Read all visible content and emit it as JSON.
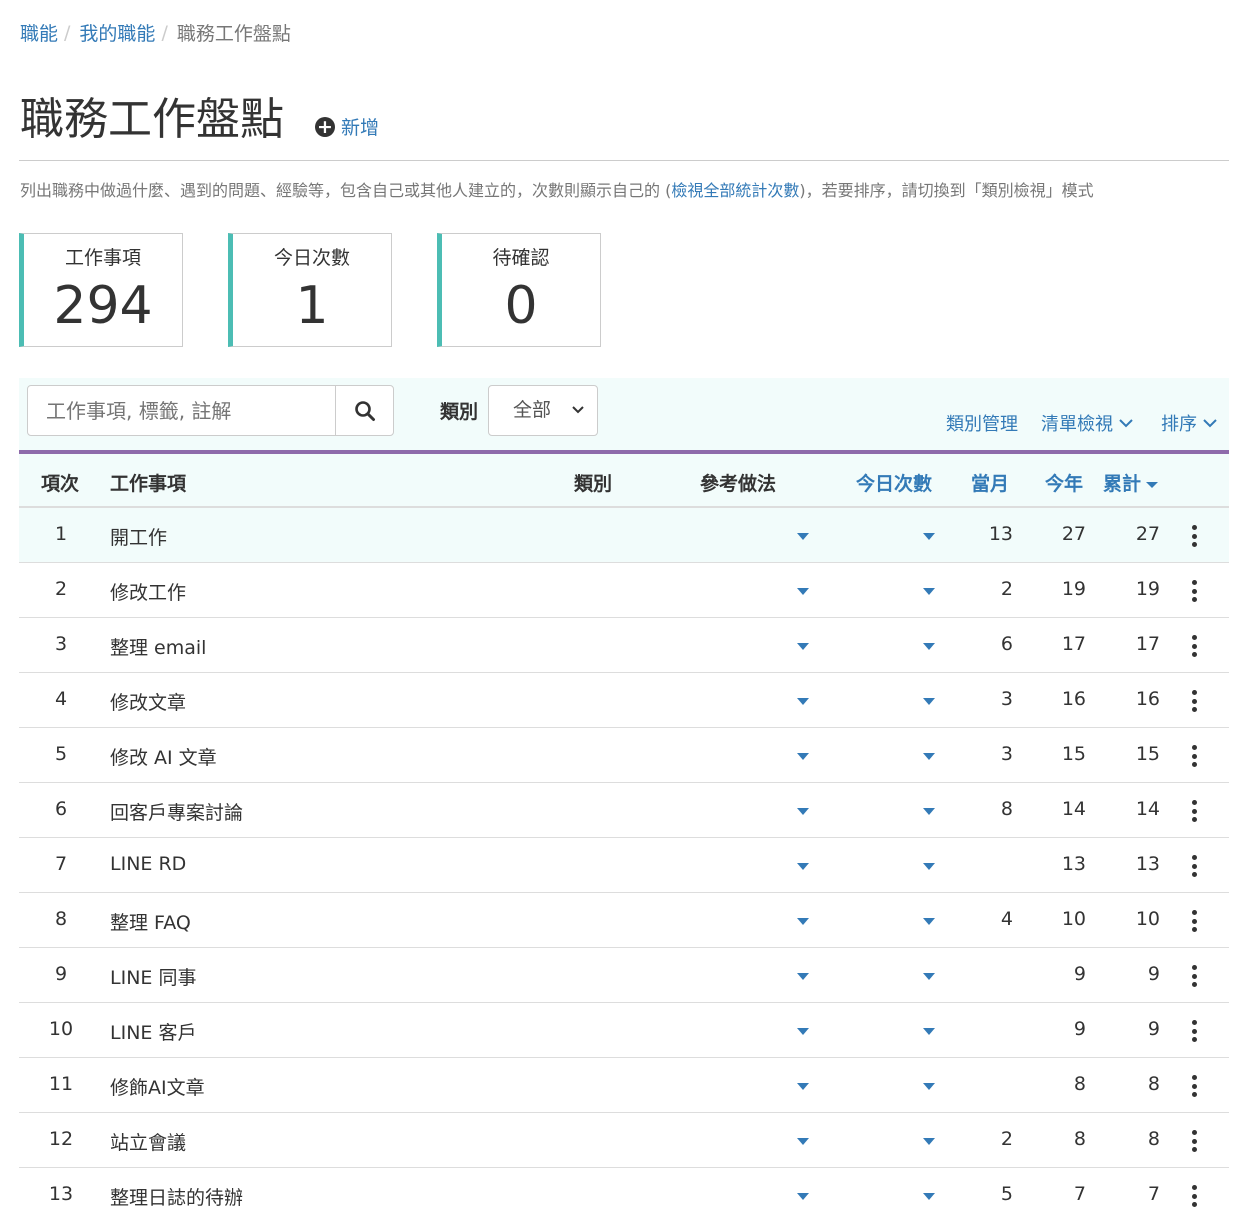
{
  "breadcrumb": {
    "items": [
      "職能",
      "我的職能"
    ],
    "current": "職務工作盤點",
    "separator": "/"
  },
  "header": {
    "title": "職務工作盤點",
    "add_label": "新增"
  },
  "description": {
    "before": "列出職務中做過什麼、遇到的問題、經驗等，包含自己或其他人建立的，次數則顯示自己的 (",
    "link": "檢視全部統計次數",
    "after": ")，若要排序，請切換到「類別檢視」模式"
  },
  "stats": [
    {
      "label": "工作事項",
      "value": "294"
    },
    {
      "label": "今日次數",
      "value": "1"
    },
    {
      "label": "待確認",
      "value": "0"
    }
  ],
  "toolbar": {
    "search_placeholder": "工作事項, 標籤, 註解",
    "category_label": "類別",
    "category_selected": "全部",
    "links": [
      "類別管理",
      "清單檢視",
      "排序"
    ]
  },
  "table": {
    "columns": [
      "項次",
      "工作事項",
      "類別",
      "參考做法",
      "今日次數",
      "當月",
      "今年",
      "累計"
    ],
    "rows": [
      {
        "no": "1",
        "item": "開工作",
        "month": "13",
        "year": "27",
        "total": "27"
      },
      {
        "no": "2",
        "item": "修改工作",
        "month": "2",
        "year": "19",
        "total": "19"
      },
      {
        "no": "3",
        "item": "整理 email",
        "month": "6",
        "year": "17",
        "total": "17"
      },
      {
        "no": "4",
        "item": "修改文章",
        "month": "3",
        "year": "16",
        "total": "16"
      },
      {
        "no": "5",
        "item": "修改 AI 文章",
        "month": "3",
        "year": "15",
        "total": "15"
      },
      {
        "no": "6",
        "item": "回客戶專案討論",
        "month": "8",
        "year": "14",
        "total": "14"
      },
      {
        "no": "7",
        "item": "LINE RD",
        "month": "",
        "year": "13",
        "total": "13"
      },
      {
        "no": "8",
        "item": "整理 FAQ",
        "month": "4",
        "year": "10",
        "total": "10"
      },
      {
        "no": "9",
        "item": "LINE 同事",
        "month": "",
        "year": "9",
        "total": "9"
      },
      {
        "no": "10",
        "item": "LINE 客戶",
        "month": "",
        "year": "9",
        "total": "9"
      },
      {
        "no": "11",
        "item": "修飾AI文章",
        "month": "",
        "year": "8",
        "total": "8"
      },
      {
        "no": "12",
        "item": "站立會議",
        "month": "2",
        "year": "8",
        "total": "8"
      },
      {
        "no": "13",
        "item": "整理日誌的待辦",
        "month": "5",
        "year": "7",
        "total": "7"
      }
    ]
  },
  "colors": {
    "link": "#337ab7",
    "stat_accent": "#4cbdb4",
    "header_border": "#8e6bab",
    "panel_bg": "#f2fcfb"
  }
}
